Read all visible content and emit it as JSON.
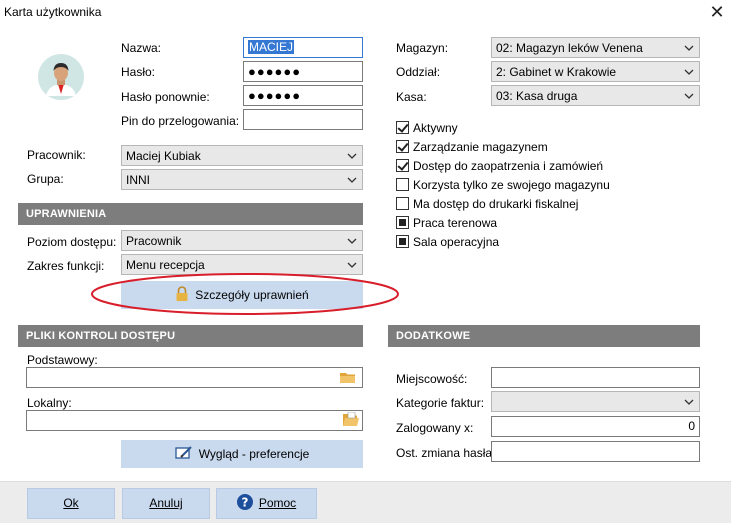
{
  "window": {
    "title": "Karta użytkownika",
    "close": "✕"
  },
  "user": {
    "nazwa_label": "Nazwa:",
    "nazwa_value": "MACIEJ",
    "haslo_label": "Hasło:",
    "haslo_value": "●●●●●●",
    "haslo2_label": "Hasło ponownie:",
    "haslo2_value": "●●●●●●",
    "pin_label": "Pin do przelogowania:",
    "pin_value": "",
    "pracownik_label": "Pracownik:",
    "pracownik_value": "Maciej Kubiak",
    "grupa_label": "Grupa:",
    "grupa_value": "INNI"
  },
  "right": {
    "magazyn_label": "Magazyn:",
    "magazyn_value": "02: Magazyn leków Venena",
    "oddzial_label": "Oddział:",
    "oddzial_value": "2: Gabinet w Krakowie",
    "kasa_label": "Kasa:",
    "kasa_value": "03: Kasa druga"
  },
  "checks": [
    {
      "label": "Aktywny",
      "state": "checked"
    },
    {
      "label": "Zarządzanie magazynem",
      "state": "checked"
    },
    {
      "label": "Dostęp do zaopatrzenia i zamówień",
      "state": "checked"
    },
    {
      "label": "Korzysta tylko ze swojego magazynu",
      "state": "unchecked"
    },
    {
      "label": "Ma dostęp do drukarki fiskalnej",
      "state": "unchecked"
    },
    {
      "label": "Praca terenowa",
      "state": "filled"
    },
    {
      "label": "Sala operacyjna",
      "state": "filled"
    }
  ],
  "uprawnienia": {
    "header": "UPRAWNIENIA",
    "poziom_label": "Poziom dostępu:",
    "poziom_value": "Pracownik",
    "zakres_label": "Zakres funkcji:",
    "zakres_value": "Menu recepcja",
    "details_button": "Szczegóły uprawnień"
  },
  "pliki": {
    "header": "PLIKI KONTROLI DOSTĘPU",
    "podstawowy_label": "Podstawowy:",
    "podstawowy_value": "",
    "lokalny_label": "Lokalny:",
    "lokalny_value": "",
    "wyglad_button": "Wygląd - preferencje"
  },
  "dodatkowe": {
    "header": "DODATKOWE",
    "miejscowosc_label": "Miejscowość:",
    "miejscowosc_value": "",
    "kategorie_label": "Kategorie faktur:",
    "kategorie_value": "",
    "zalogowany_label": "Zalogowany x:",
    "zalogowany_value": "0",
    "ost_zmiana_label": "Ost. zmiana hasła:",
    "ost_zmiana_value": ""
  },
  "footer": {
    "ok": "Ok",
    "anuluj": "Anuluj",
    "pomoc": "Pomoc"
  },
  "colors": {
    "section": "#7d7d7d",
    "button": "#c9d9ee",
    "highlight": "#3478d4",
    "ellipse": "#d81e2a"
  }
}
